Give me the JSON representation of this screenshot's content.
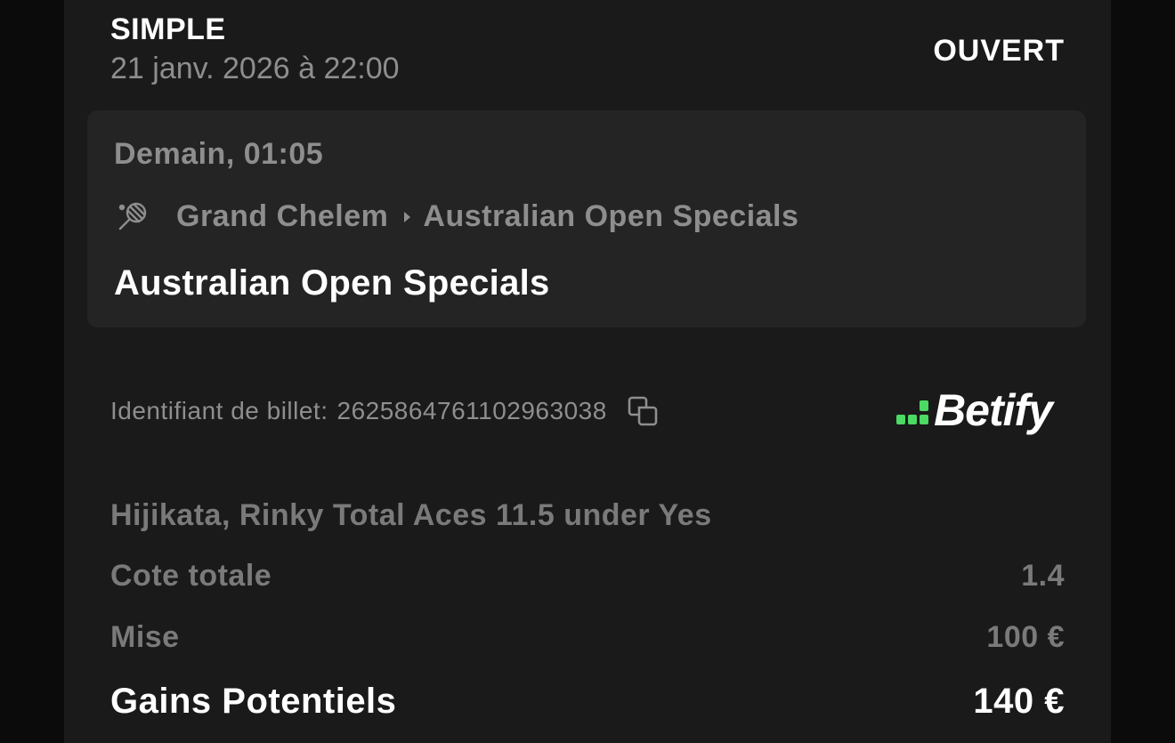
{
  "ticket": {
    "bet_type": "SIMPLE",
    "placed_at": "21 janv. 2026 à 22:00",
    "status": "OUVERT"
  },
  "event": {
    "time": "Demain, 01:05",
    "sport_icon": "tennis-icon",
    "breadcrumb": [
      "Grand Chelem",
      "Australian Open Specials"
    ],
    "name": "Australian Open Specials"
  },
  "ticket_id": {
    "label": "Identifiant de billet:",
    "value": "2625864761102963038",
    "copy_icon": "copy-icon"
  },
  "brand": {
    "name": "Betify",
    "accent": "#4cd964"
  },
  "selection": "Hijikata, Rinky Total Aces 11.5 under Yes",
  "summary": {
    "odds_label": "Cote totale",
    "odds_value": "1.4",
    "stake_label": "Mise",
    "stake_value": "100 €",
    "gains_label": "Gains Potentiels",
    "gains_value": "140 €"
  }
}
